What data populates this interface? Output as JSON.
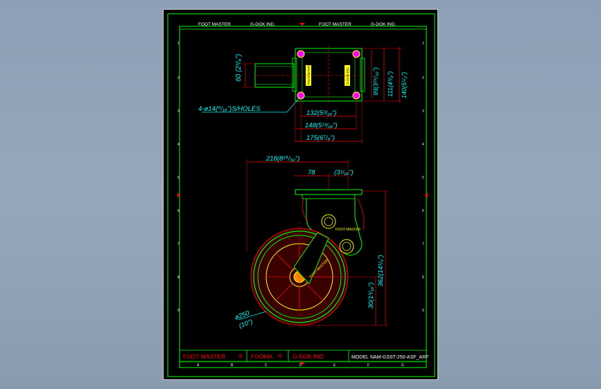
{
  "header": {
    "left": [
      "FOOT MASTER",
      "G-DOK IND."
    ],
    "right": [
      "FOOT MASTER",
      "G-DOK IND."
    ]
  },
  "columns": [
    "A",
    "B",
    "C",
    "D",
    "E",
    "F",
    "G"
  ],
  "rows": [
    "1",
    "2",
    "3",
    "4",
    "5",
    "6",
    "7",
    "8",
    "9"
  ],
  "top_view": {
    "dim_height": "60",
    "dim_height_inch": "(2³/₈\")",
    "dim_99": "99(3²⁹/₃₂\")",
    "dim_111": "111(4³/₈\")",
    "dim_140": "140(5¹/₂\")",
    "holes": "4-ø14(⁹/₁₆\")S/HOLES",
    "dim_132": "132(5³/₁₆\")",
    "dim_148": "148(5¹³/₁₆\")",
    "dim_175": "175(6⁷/₈\")",
    "plate_label_left": "FOOT MASTER",
    "plate_label_right": "G-DOK IND."
  },
  "side_view": {
    "dim_218": "218(8¹⁹/₃₂\")",
    "dim_78": "78",
    "dim_78_inch": "(3¹/₁₆\")",
    "dim_362": "362(14¹/₄\")",
    "dim_30": "30(1³/₁₆\")",
    "dim_dia": "ø250",
    "dim_dia_inch": "(10\")",
    "bracket_label": "FOOT MASTER",
    "wheel_label": "FOOT MASTER"
  },
  "title_block": {
    "brand1": "FOOT MASTER",
    "brand2": "FOOMA",
    "brand3": "G-DOK IND",
    "model_label": "MODEL",
    "model_value": "NAM-GSST-250-ASF_ARF"
  },
  "colors": {
    "background": "#000000",
    "border": "#00ff00",
    "dimension": "#ff0000",
    "text": "#ffffff",
    "leader": "#00ffff",
    "part": "#ffff00"
  }
}
